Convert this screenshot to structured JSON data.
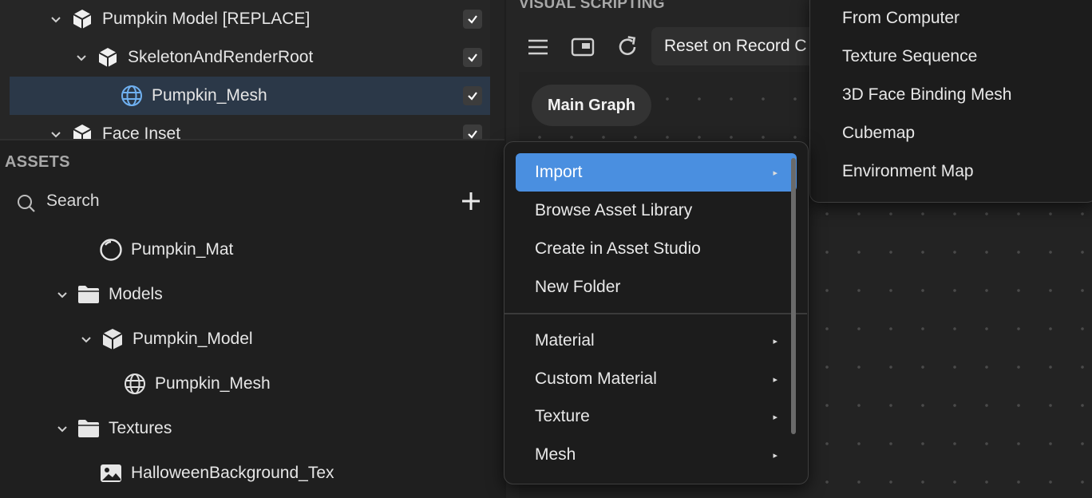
{
  "scene": {
    "rows": [
      {
        "label": "Pumpkin Model [REPLACE]",
        "icon": "model-icon"
      },
      {
        "label": "SkeletonAndRenderRoot",
        "icon": "model-icon"
      },
      {
        "label": "Pumpkin_Mesh",
        "icon": "mesh-icon",
        "selected": true
      },
      {
        "label": "Face Inset",
        "icon": "model-icon"
      }
    ]
  },
  "assets": {
    "title": "ASSETS",
    "search_label": "Search",
    "items": [
      {
        "label": "Pumpkin_Mat",
        "icon": "material-icon"
      },
      {
        "label": "Models",
        "icon": "folder-icon"
      },
      {
        "label": "Pumpkin_Model",
        "icon": "cube-icon"
      },
      {
        "label": "Pumpkin_Mesh",
        "icon": "mesh-icon"
      },
      {
        "label": "Textures",
        "icon": "folder-icon"
      },
      {
        "label": "HalloweenBackground_Tex",
        "icon": "image-icon"
      }
    ]
  },
  "visual_scripting": {
    "title": "VISUAL SCRIPTING",
    "reset_label": "Reset on Record C",
    "main_graph_tab": "Main Graph"
  },
  "context_menu": {
    "items": [
      {
        "label": "Import",
        "submenu": true,
        "active": true
      },
      {
        "label": "Browse Asset Library"
      },
      {
        "label": "Create in Asset Studio"
      },
      {
        "label": "New Folder"
      },
      {
        "label": "Material",
        "submenu": true
      },
      {
        "label": "Custom Material",
        "submenu": true
      },
      {
        "label": "Texture",
        "submenu": true
      },
      {
        "label": "Mesh",
        "submenu": true
      }
    ],
    "arrow_glyph": "▸"
  },
  "import_submenu": {
    "items": [
      "From Computer",
      "Texture Sequence",
      "3D Face Binding Mesh",
      "Cubemap",
      "Environment Map"
    ]
  },
  "colors": {
    "accent": "#4a8fe0",
    "selection": "#2b3848",
    "panel": "#1f1f1f"
  }
}
